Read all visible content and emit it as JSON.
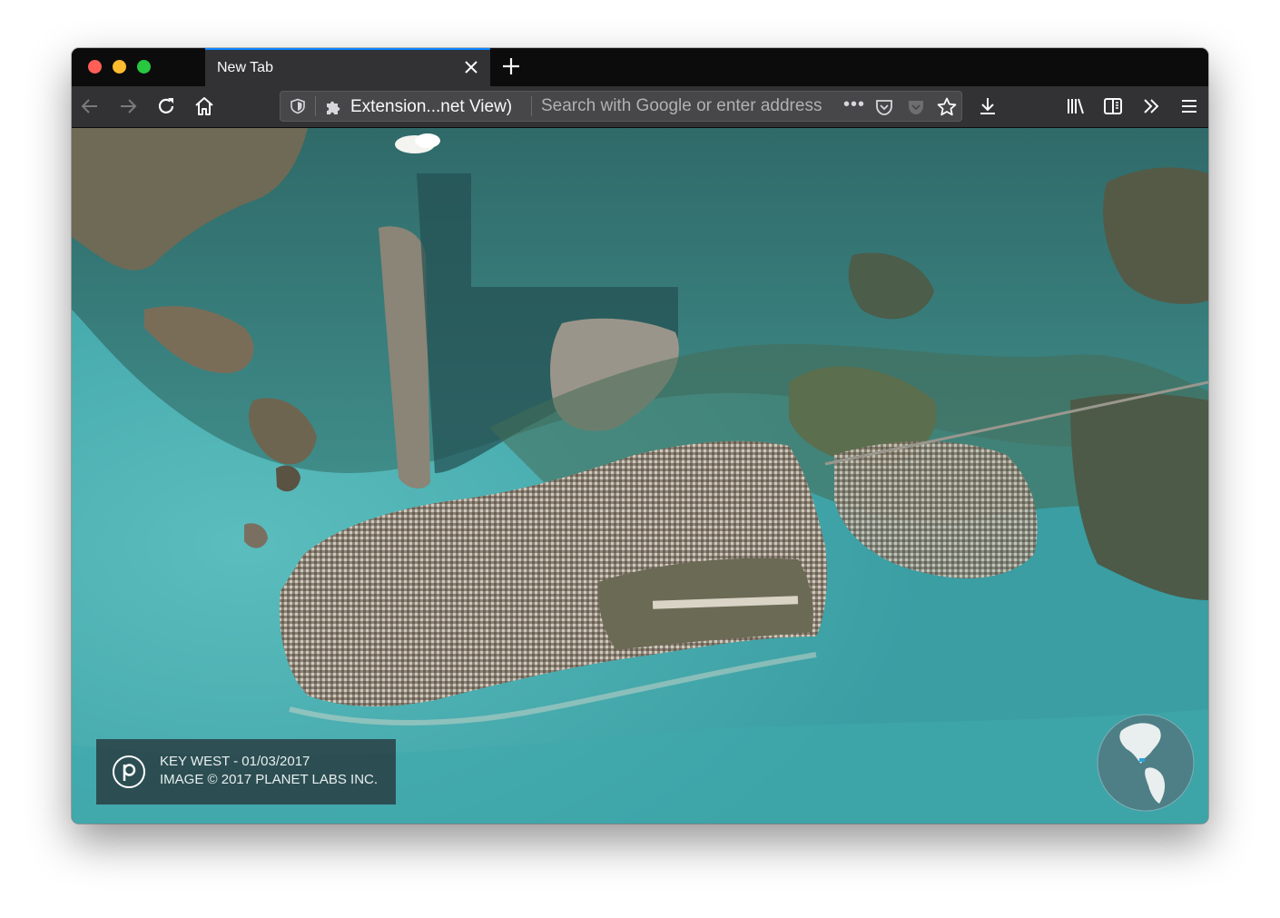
{
  "window": {
    "controls": [
      "close",
      "minimize",
      "maximize"
    ]
  },
  "tabs": [
    {
      "title": "New Tab",
      "active": true,
      "close_icon": "close-icon"
    }
  ],
  "new_tab_icon": "plus-icon",
  "toolbar": {
    "back_icon": "back-arrow-icon",
    "forward_icon": "forward-arrow-icon",
    "reload_icon": "reload-icon",
    "home_icon": "home-icon",
    "downloads_icon": "download-icon",
    "library_icon": "library-icon",
    "sidebar_icon": "sidebar-icon",
    "overflow_icon": "chevron-double-right-icon",
    "menu_icon": "hamburger-menu-icon"
  },
  "urlbar": {
    "tracking_icon": "shield-icon",
    "extension_icon": "puzzle-piece-icon",
    "extension_label": "Extension...net View)",
    "placeholder": "Search with Google or enter address",
    "page_actions": "•••",
    "pocket_icon": "pocket-icon",
    "bookmark_icon": "star-icon"
  },
  "content": {
    "attribution": {
      "logo": "planet-p-logo",
      "line1": "KEY WEST - 01/03/2017",
      "line2": "IMAGE © 2017 PLANET LABS INC."
    },
    "globe_icon": "globe-icon"
  },
  "colors": {
    "accent": "#0a84ff",
    "toolbar_bg": "#323234",
    "tabstrip_bg": "#0c0c0d",
    "water": "#3a8f93"
  }
}
